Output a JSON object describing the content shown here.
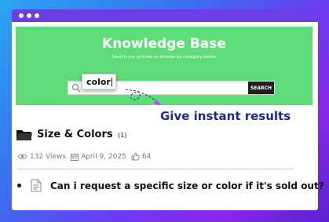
{
  "hero": {
    "title": "Knowledge Base",
    "subtitle": "Search our articles or browse by category below",
    "search_button_label": "SEARCH",
    "search_value": "color",
    "background_color": "#5edc7a"
  },
  "callout": {
    "text": "Give instant results",
    "color": "#1e2b8c"
  },
  "category": {
    "name": "Size & Colors",
    "count": "(1)"
  },
  "meta": {
    "views": "132 Views",
    "date": "April 9, 2025",
    "likes": "64"
  },
  "article": {
    "title": "Can i request a specific size or color if it's sold out?"
  },
  "icons": [
    "search-icon",
    "folder-icon",
    "eye-icon",
    "calendar-icon",
    "thumbs-up-icon",
    "document-icon",
    "arrow-icon",
    "cursor-icon"
  ],
  "colors": {
    "window_titlebar": "#6b3de6",
    "divider": "#9ee2a6"
  }
}
